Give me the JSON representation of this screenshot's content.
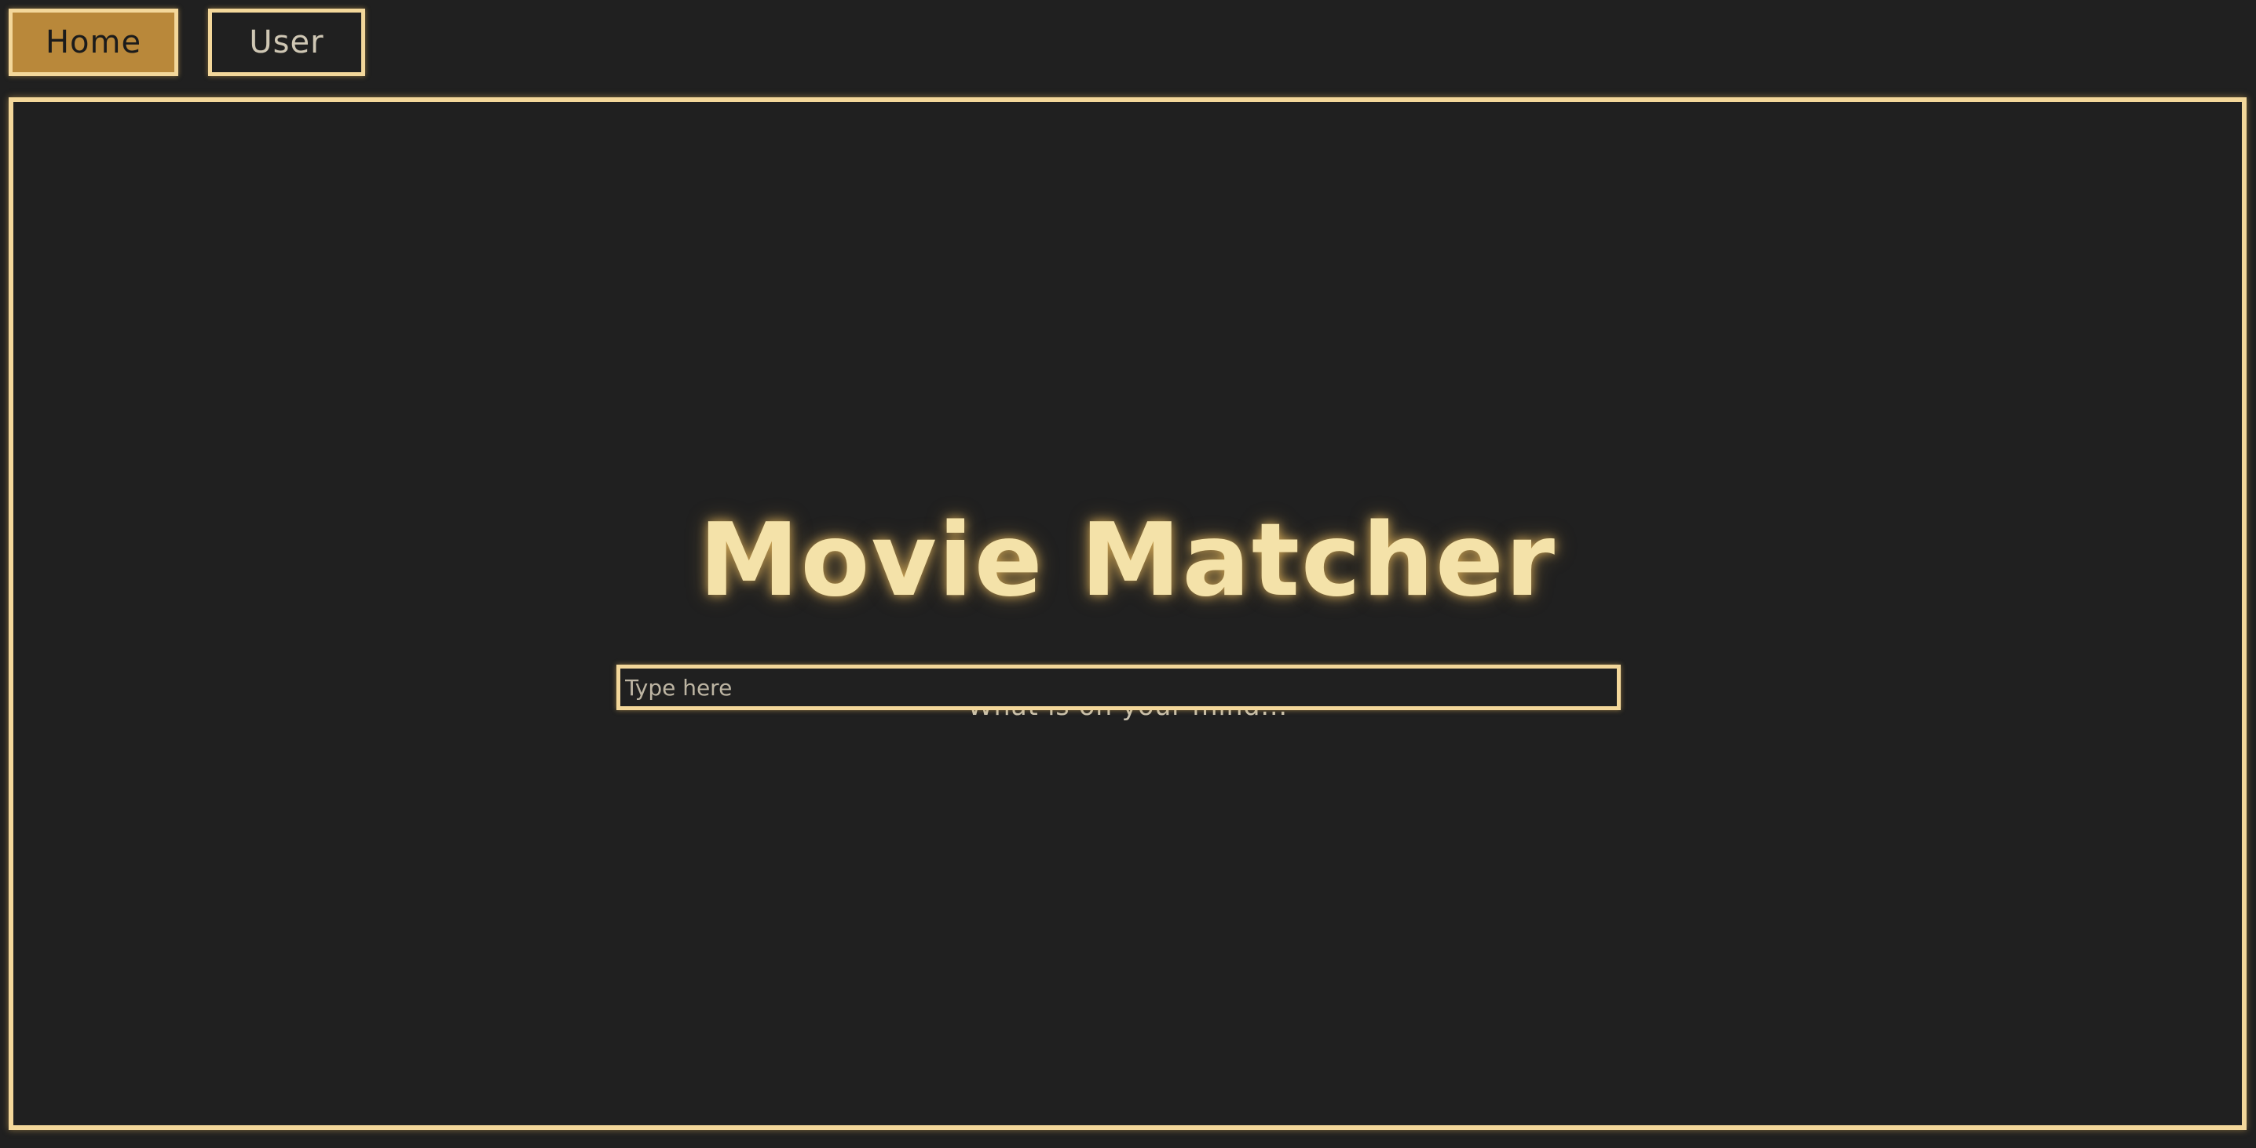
{
  "nav": {
    "home_label": "Home",
    "user_label": "User",
    "active": "Home"
  },
  "main": {
    "title": "Movie Matcher",
    "prompt": "What is on your mind...",
    "search": {
      "placeholder": "Type here",
      "value": ""
    }
  },
  "colors": {
    "background": "#202020",
    "accent_border": "#f3d79a",
    "active_button": "#b9883a",
    "title_text": "#f4e2a9"
  }
}
